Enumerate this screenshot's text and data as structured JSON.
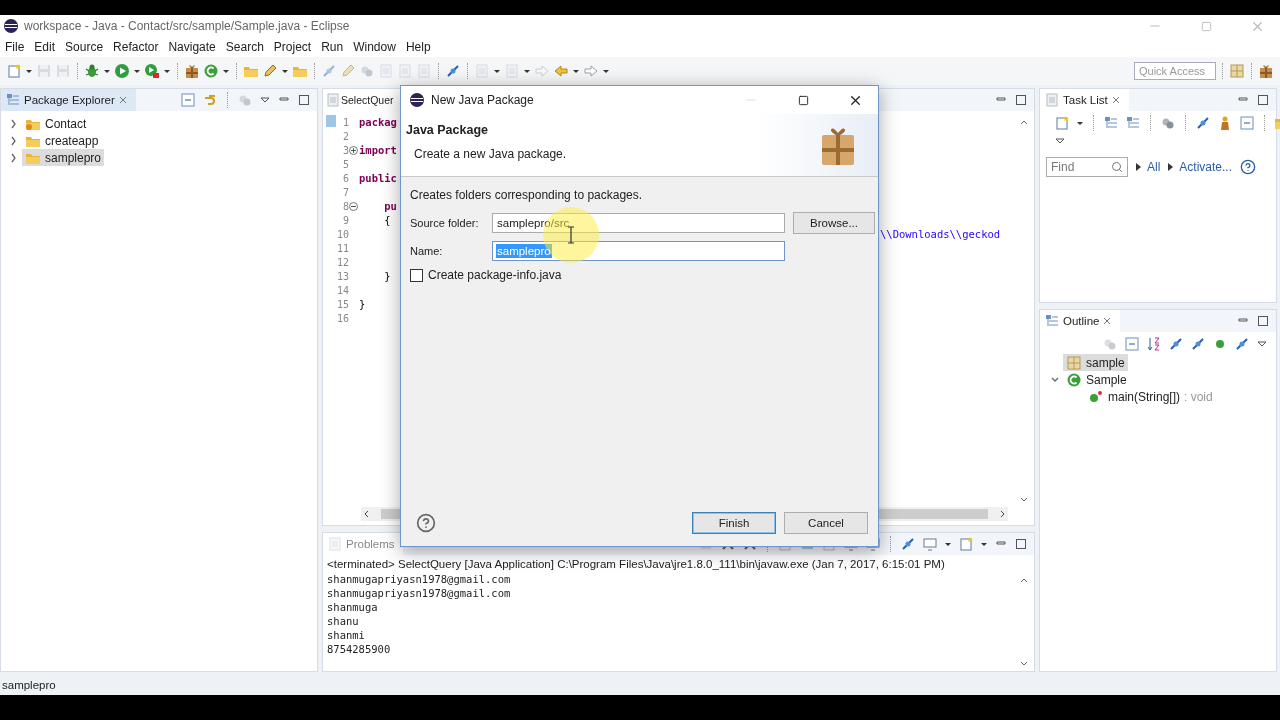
{
  "window": {
    "title": "workspace - Java - Contact/src/sample/Sample.java - Eclipse"
  },
  "menu": [
    "File",
    "Edit",
    "Source",
    "Refactor",
    "Navigate",
    "Search",
    "Project",
    "Run",
    "Window",
    "Help"
  ],
  "quick_access": {
    "placeholder": "Quick Access"
  },
  "package_explorer": {
    "title": "Package Explorer",
    "items": [
      {
        "label": "Contact",
        "kind": "decorated",
        "expanded": false,
        "selected": false
      },
      {
        "label": "createapp",
        "kind": "plain",
        "expanded": false,
        "selected": false
      },
      {
        "label": "samplepro",
        "kind": "plain",
        "expanded": false,
        "selected": true
      }
    ]
  },
  "editor": {
    "tab": "SelectQuer",
    "lines": [
      {
        "number": "1",
        "code": "packag",
        "kind": "keyword"
      },
      {
        "number": "2"
      },
      {
        "number": "3",
        "folded": true,
        "code": "import",
        "kind": "keyword"
      },
      {
        "number": "5"
      },
      {
        "number": "6",
        "code": "public",
        "kind": "keyword"
      },
      {
        "number": "7"
      },
      {
        "number": "8",
        "folded": false,
        "code": "    pu",
        "kind": "keyword"
      },
      {
        "number": "9",
        "code": "    {",
        "kind": "plain"
      },
      {
        "number": "10",
        "tail": "\\\\Downloads\\\\geckod"
      },
      {
        "number": "11"
      },
      {
        "number": "12"
      },
      {
        "number": "13",
        "code": "    }",
        "kind": "plain"
      },
      {
        "number": "14"
      },
      {
        "number": "15",
        "code": "}",
        "kind": "plain"
      },
      {
        "number": "16"
      }
    ]
  },
  "console": {
    "tab": "Problems",
    "header": "<terminated> SelectQuery [Java Application] C:\\Program Files\\Java\\jre1.8.0_111\\bin\\javaw.exe (Jan 7, 2017, 6:15:01 PM)",
    "output": [
      "shanmugapriyasn1978@gmail.com",
      "shanmugapriyasn1978@gmail.com",
      "shanmuga",
      "shanu",
      "shanmi",
      "8754285900"
    ]
  },
  "task_list": {
    "title": "Task List",
    "find": {
      "placeholder": "Find"
    },
    "links": [
      "All",
      "Activate..."
    ]
  },
  "outline": {
    "title": "Outline",
    "items": [
      {
        "label": "sample",
        "kind": "package",
        "selected": true
      },
      {
        "label": "Sample",
        "kind": "class",
        "selected": false,
        "expanded": true,
        "children": [
          {
            "label": "main(String[])",
            "type": ": void",
            "kind": "method",
            "selected": false
          }
        ]
      }
    ]
  },
  "status_bar": {
    "text": "samplepro"
  },
  "dialog": {
    "title": "New Java Package",
    "heading": "Java Package",
    "subtitle": "Create a new Java package.",
    "description": "Creates folders corresponding to packages.",
    "fields": [
      {
        "label": "Source folder:",
        "value": "samplepro/src",
        "text_selected": false,
        "button": "Browse..."
      },
      {
        "label": "Name:",
        "value": "samplepro",
        "text_selected": true
      }
    ],
    "checkbox": {
      "label": "Create package-info.java",
      "checked": false
    },
    "buttons": [
      {
        "label": "Finish",
        "default": true
      },
      {
        "label": "Cancel",
        "default": false
      }
    ]
  }
}
